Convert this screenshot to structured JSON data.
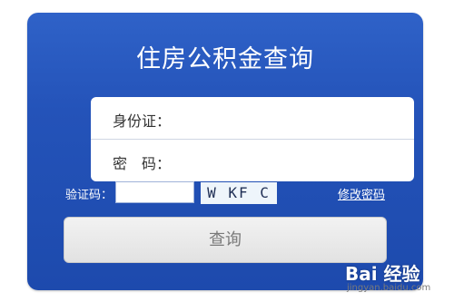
{
  "panel": {
    "title": "住房公积金查询"
  },
  "form": {
    "id_label": "身份证：",
    "id_value": "",
    "password_label": "密　码：",
    "password_value": ""
  },
  "captcha": {
    "label": "验证码：",
    "input_value": "",
    "image_text": "W KF C"
  },
  "links": {
    "change_password": "修改密码"
  },
  "buttons": {
    "query": "查询"
  },
  "watermark": {
    "logo_text": "Bai 经验",
    "url": "jingyan.baidu.com"
  },
  "colors": {
    "panel_blue": "#2453b9",
    "button_gray": "#e6e6e6",
    "captcha_bg": "#eef5fb"
  }
}
